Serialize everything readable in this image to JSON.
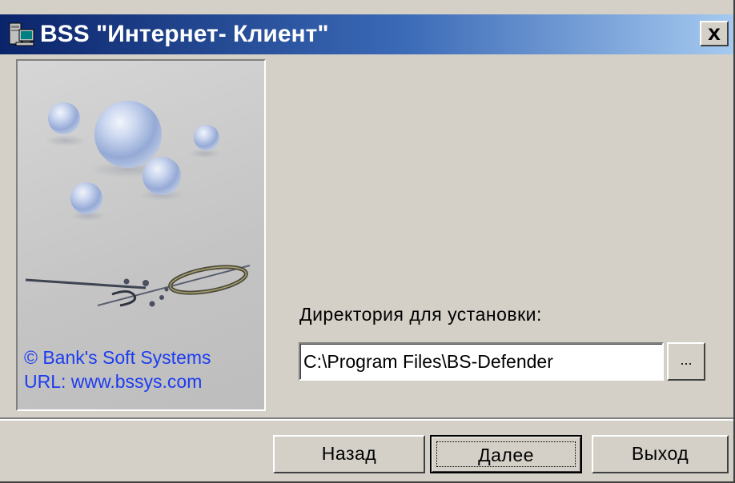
{
  "window": {
    "title": "BSS \"Интернет- Клиент\"",
    "close_label": "x"
  },
  "side_panel": {
    "copyright_line": "© Bank's Soft Systems",
    "url_line": "URL:  www.bssys.com"
  },
  "install": {
    "directory_label": "Директория  для установки:",
    "directory_value": "C:\\Program Files\\BS-Defender",
    "browse_label": "..."
  },
  "buttons": {
    "back_label": "Назад",
    "next_label": "Далее",
    "exit_label": "Выход"
  },
  "icons": {
    "app": "installer-computer-icon",
    "close": "close-icon"
  },
  "colors": {
    "title_gradient_start": "#0a246a",
    "title_gradient_end": "#a6caf0",
    "face": "#d4d0c8",
    "link_text": "#1d3cf0"
  }
}
